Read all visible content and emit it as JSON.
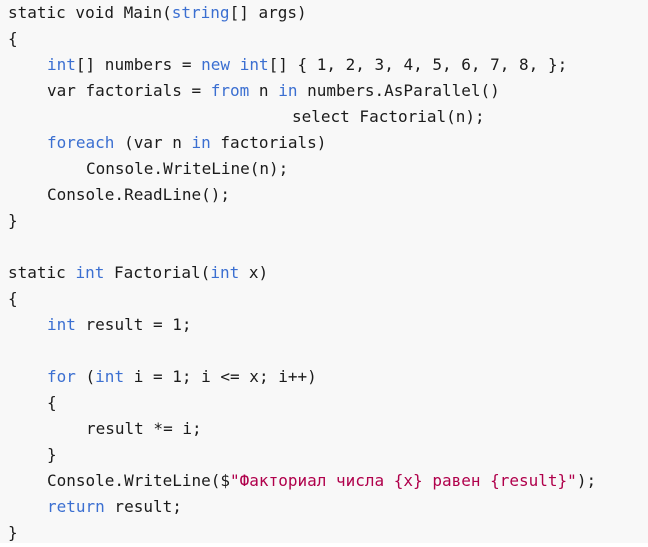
{
  "code": {
    "lines": [
      {
        "indent": 0,
        "tokens": [
          {
            "t": "static void ",
            "k": "txt"
          },
          {
            "t": "Main",
            "k": "txt"
          },
          {
            "t": "(",
            "k": "txt"
          },
          {
            "t": "string",
            "k": "kw"
          },
          {
            "t": "[] args)",
            "k": "txt"
          }
        ]
      },
      {
        "indent": 0,
        "tokens": [
          {
            "t": "{",
            "k": "txt"
          }
        ]
      },
      {
        "indent": 1,
        "tokens": [
          {
            "t": "int",
            "k": "kw"
          },
          {
            "t": "[] numbers = ",
            "k": "txt"
          },
          {
            "t": "new",
            "k": "kw"
          },
          {
            "t": " ",
            "k": "txt"
          },
          {
            "t": "int",
            "k": "kw"
          },
          {
            "t": "[] { 1, 2, 3, 4, 5, 6, 7, 8, };",
            "k": "txt"
          }
        ]
      },
      {
        "indent": 1,
        "tokens": [
          {
            "t": "var factorials = ",
            "k": "txt"
          },
          {
            "t": "from",
            "k": "kw"
          },
          {
            "t": " n ",
            "k": "txt"
          },
          {
            "t": "in",
            "k": "kw"
          },
          {
            "t": " numbers.AsParallel()",
            "k": "txt"
          }
        ]
      },
      {
        "indent": "x",
        "tokens": [
          {
            "t": "select Factorial(n);",
            "k": "txt"
          }
        ]
      },
      {
        "indent": 1,
        "tokens": [
          {
            "t": "foreach",
            "k": "kw"
          },
          {
            "t": " (var n ",
            "k": "txt"
          },
          {
            "t": "in",
            "k": "kw"
          },
          {
            "t": " factorials)",
            "k": "txt"
          }
        ]
      },
      {
        "indent": 2,
        "tokens": [
          {
            "t": "Console.WriteLine(n);",
            "k": "txt"
          }
        ]
      },
      {
        "indent": 1,
        "tokens": [
          {
            "t": "Console.ReadLine();",
            "k": "txt"
          }
        ]
      },
      {
        "indent": 0,
        "tokens": [
          {
            "t": "}",
            "k": "txt"
          }
        ]
      },
      {
        "indent": 0,
        "tokens": []
      },
      {
        "indent": 0,
        "tokens": [
          {
            "t": "static ",
            "k": "txt"
          },
          {
            "t": "int",
            "k": "kw"
          },
          {
            "t": " Factorial(",
            "k": "txt"
          },
          {
            "t": "int",
            "k": "kw"
          },
          {
            "t": " x)",
            "k": "txt"
          }
        ]
      },
      {
        "indent": 0,
        "tokens": [
          {
            "t": "{",
            "k": "txt"
          }
        ]
      },
      {
        "indent": 1,
        "tokens": [
          {
            "t": "int",
            "k": "kw"
          },
          {
            "t": " result = 1;",
            "k": "txt"
          }
        ]
      },
      {
        "indent": 0,
        "tokens": []
      },
      {
        "indent": 1,
        "tokens": [
          {
            "t": "for",
            "k": "kw"
          },
          {
            "t": " (",
            "k": "txt"
          },
          {
            "t": "int",
            "k": "kw"
          },
          {
            "t": " i = 1; i <= x; i++)",
            "k": "txt"
          }
        ]
      },
      {
        "indent": 1,
        "tokens": [
          {
            "t": "{",
            "k": "txt"
          }
        ]
      },
      {
        "indent": 2,
        "tokens": [
          {
            "t": "result *= i;",
            "k": "txt"
          }
        ]
      },
      {
        "indent": 1,
        "tokens": [
          {
            "t": "}",
            "k": "txt"
          }
        ]
      },
      {
        "indent": 1,
        "tokens": [
          {
            "t": "Console.WriteLine($",
            "k": "txt"
          },
          {
            "t": "\"Факториал числа {x} равен {result}\"",
            "k": "str"
          },
          {
            "t": ");",
            "k": "txt"
          }
        ]
      },
      {
        "indent": 1,
        "tokens": [
          {
            "t": "return",
            "k": "kw"
          },
          {
            "t": " result;",
            "k": "txt"
          }
        ]
      },
      {
        "indent": 0,
        "tokens": [
          {
            "t": "}",
            "k": "txt"
          }
        ]
      }
    ]
  },
  "colors": {
    "keyword": "#3b6fd1",
    "string": "#b0004b",
    "text": "#1b1b1b",
    "background": "#f8f8f8"
  }
}
